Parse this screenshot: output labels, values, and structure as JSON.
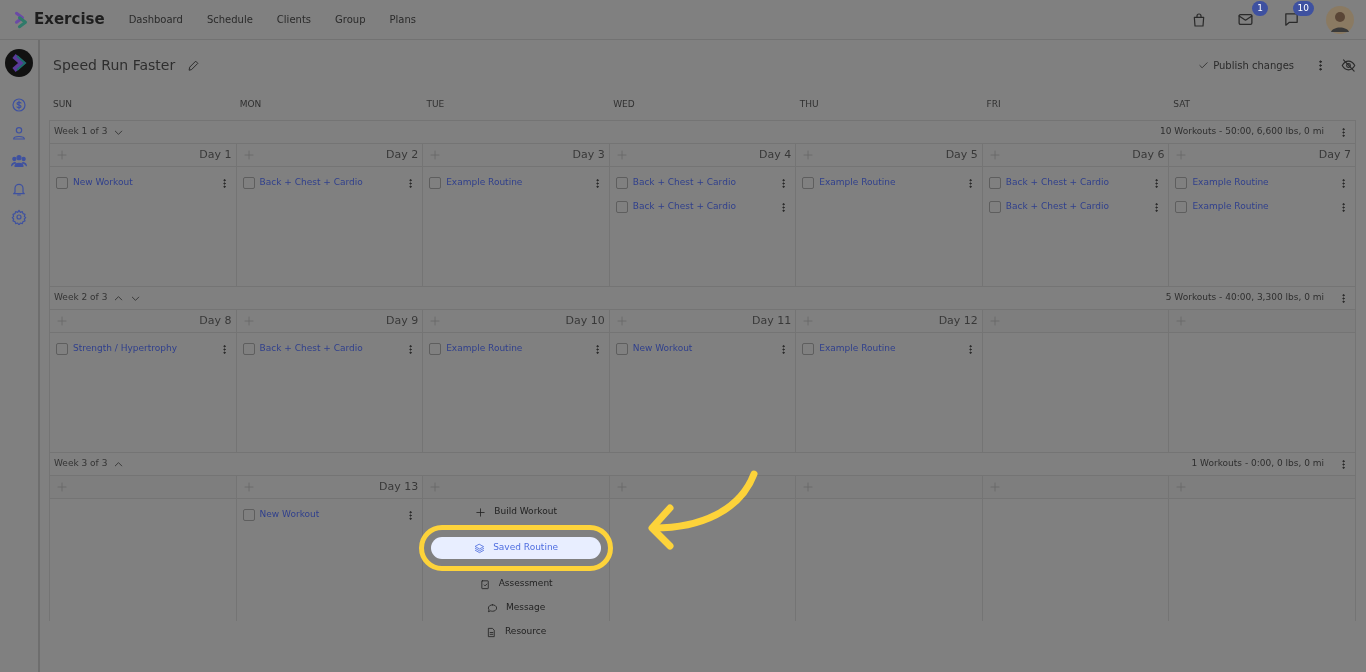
{
  "app": {
    "name": "Exercise"
  },
  "nav": [
    {
      "label": "Dashboard"
    },
    {
      "label": "Schedule"
    },
    {
      "label": "Clients"
    },
    {
      "label": "Group"
    },
    {
      "label": "Plans"
    }
  ],
  "badges": {
    "mail": "1",
    "chat": "10"
  },
  "program": {
    "title": "Speed Run Faster",
    "publish": "Publish changes"
  },
  "weekdays": [
    "SUN",
    "MON",
    "TUE",
    "WED",
    "THU",
    "FRI",
    "SAT"
  ],
  "weeks": [
    {
      "label": "Week 1 of 3",
      "can_move_up": false,
      "can_move_down": true,
      "summary": "10 Workouts - 50:00, 6,600 lbs, 0 mi",
      "days": [
        {
          "kind": "day",
          "day_label": "Day 1",
          "workouts": [
            {
              "name": "New Workout",
              "checked": false
            }
          ]
        },
        {
          "kind": "day",
          "day_label": "Day 2",
          "workouts": [
            {
              "name": "Back + Chest + Cardio",
              "checked": false
            }
          ]
        },
        {
          "kind": "day",
          "day_label": "Day 3",
          "workouts": [
            {
              "name": "Example Routine",
              "checked": false
            }
          ]
        },
        {
          "kind": "day",
          "day_label": "Day 4",
          "workouts": [
            {
              "name": "Back + Chest + Cardio",
              "checked": false
            },
            {
              "name": "Back + Chest + Cardio",
              "checked": false
            }
          ]
        },
        {
          "kind": "day",
          "day_label": "Day 5",
          "workouts": [
            {
              "name": "Example Routine",
              "checked": false
            }
          ]
        },
        {
          "kind": "day",
          "day_label": "Day 6",
          "workouts": [
            {
              "name": "Back + Chest + Cardio",
              "checked": false
            },
            {
              "name": "Back + Chest + Cardio",
              "checked": false
            }
          ]
        },
        {
          "kind": "day",
          "day_label": "Day 7",
          "workouts": [
            {
              "name": "Example Routine",
              "checked": false
            },
            {
              "name": "Example Routine",
              "checked": false
            }
          ]
        }
      ]
    },
    {
      "label": "Week 2 of 3",
      "can_move_up": true,
      "can_move_down": true,
      "summary": "5 Workouts - 40:00, 3,300 lbs, 0 mi",
      "days": [
        {
          "kind": "day",
          "day_label": "Day 8",
          "workouts": [
            {
              "name": "Strength / Hypertrophy",
              "checked": false
            }
          ]
        },
        {
          "kind": "day",
          "day_label": "Day 9",
          "workouts": [
            {
              "name": "Back + Chest + Cardio",
              "checked": false
            }
          ]
        },
        {
          "kind": "day",
          "day_label": "Day 10",
          "workouts": [
            {
              "name": "Example Routine",
              "checked": false
            }
          ]
        },
        {
          "kind": "day",
          "day_label": "Day 11",
          "workouts": [
            {
              "name": "New Workout",
              "checked": false
            }
          ]
        },
        {
          "kind": "day",
          "day_label": "Day 12",
          "workouts": [
            {
              "name": "Example Routine",
              "checked": false
            }
          ]
        },
        {
          "kind": "blank"
        },
        {
          "kind": "blank"
        }
      ]
    },
    {
      "label": "Week 3 of 3",
      "can_move_up": true,
      "can_move_down": false,
      "summary": "1 Workouts - 0:00, 0 lbs, 0 mi",
      "days": [
        {
          "kind": "blank"
        },
        {
          "kind": "day",
          "day_label": "Day 13",
          "workouts": [
            {
              "name": "New Workout",
              "checked": false
            }
          ]
        },
        {
          "kind": "blank",
          "menu": [
            {
              "kind": "build",
              "label": "Build Workout",
              "selected": false
            },
            {
              "kind": "saved",
              "label": "Saved Routine",
              "selected": true
            },
            {
              "kind": "assessment",
              "label": "Assessment",
              "selected": false
            },
            {
              "kind": "message",
              "label": "Message",
              "selected": false
            },
            {
              "kind": "resource",
              "label": "Resource",
              "selected": false
            }
          ]
        },
        {
          "kind": "blank"
        },
        {
          "kind": "blank"
        },
        {
          "kind": "blank"
        },
        {
          "kind": "blank"
        }
      ]
    }
  ]
}
